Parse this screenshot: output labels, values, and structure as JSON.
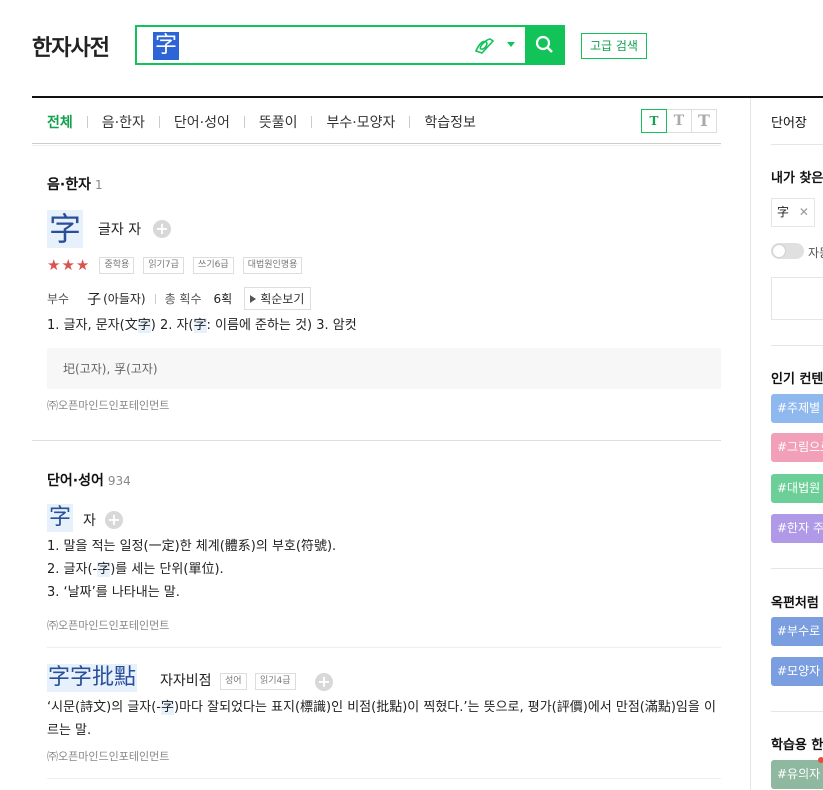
{
  "header": {
    "logo": "한자사전",
    "search_value": "字",
    "advanced_label": "고급 검색"
  },
  "tabs": [
    {
      "label": "전체"
    },
    {
      "label": "음·한자"
    },
    {
      "label": "단어·성어"
    },
    {
      "label": "뜻풀이"
    },
    {
      "label": "부수·모양자"
    },
    {
      "label": "학습정보"
    }
  ],
  "font_sizes": [
    "T",
    "T",
    "T"
  ],
  "section_hanja": {
    "title": "음·한자",
    "count": "1",
    "char": "字",
    "reading": "글자 자",
    "stars": "★★★",
    "badges": [
      "중학용",
      "읽기7급",
      "쓰기6급",
      "대법원인명용"
    ],
    "radical_label": "부수",
    "radical_char": "子",
    "radical_name": "(아들자)",
    "strokes_label": "총 획수",
    "strokes": "6획",
    "stroke_order_btn": "획순보기",
    "meaning": {
      "p1": "1. 글자, 문자(文",
      "hl1": "字",
      "p2": ")  2. 자(",
      "hl2": "字",
      "p3": ": 이름에 준하는 것)  3. 암컷"
    },
    "variants": "𡉏(고자), 孚(고자)",
    "copyright": "㈜오픈마인드인포테인먼트"
  },
  "section_words": {
    "title": "단어·성어",
    "count": "934",
    "entry1": {
      "char": "字",
      "reading": "자",
      "def1": "1. 말을 적는 일정(一定)한 체계(體系)의 부호(符號).",
      "def2_a": "2. 글자(-",
      "def2_hl": "字",
      "def2_b": ")를 세는 단위(單位).",
      "def3": "3. ‘날짜’를 나타내는 말.",
      "copyright": "㈜오픈마인드인포테인먼트"
    },
    "entry2": {
      "chars": "字字批點",
      "reading": "자자비점",
      "badges": [
        "성어",
        "읽기4급"
      ],
      "def_a": "‘시문(詩文)의 글자(-",
      "def_hl": "字",
      "def_b": ")마다 잘되었다는 표지(標識)인 비점(批點)이 찍혔다.’는 뜻으로, 평가(評價)에서 만점(滿點)임을 이르는 말.",
      "copyright": "㈜오픈마인드인포테인먼트"
    }
  },
  "right_panel": {
    "wordbook": "단어장",
    "recent_title": "내가 찾은",
    "recent_chip": "字",
    "toggle_label": "자동",
    "popular_title": "인기 컨텐츠",
    "tags": [
      {
        "label": "#주제별",
        "color": "#8fb8ef"
      },
      {
        "label": "#그림으로",
        "color": "#f2a0b8"
      },
      {
        "label": "#대법원",
        "color": "#6ccf98"
      },
      {
        "label": "#한자 주",
        "color": "#b09ae8"
      }
    ],
    "okpyeon_title": "옥편처럼",
    "okpyeon_tags": [
      {
        "label": "#부수로",
        "color": "#7b9ee0"
      },
      {
        "label": "#모양자",
        "color": "#7b9ee0"
      }
    ],
    "study_title": "학습용 한",
    "study_tags": [
      {
        "label": "#유의자",
        "color": "#8fb8a0"
      }
    ]
  }
}
